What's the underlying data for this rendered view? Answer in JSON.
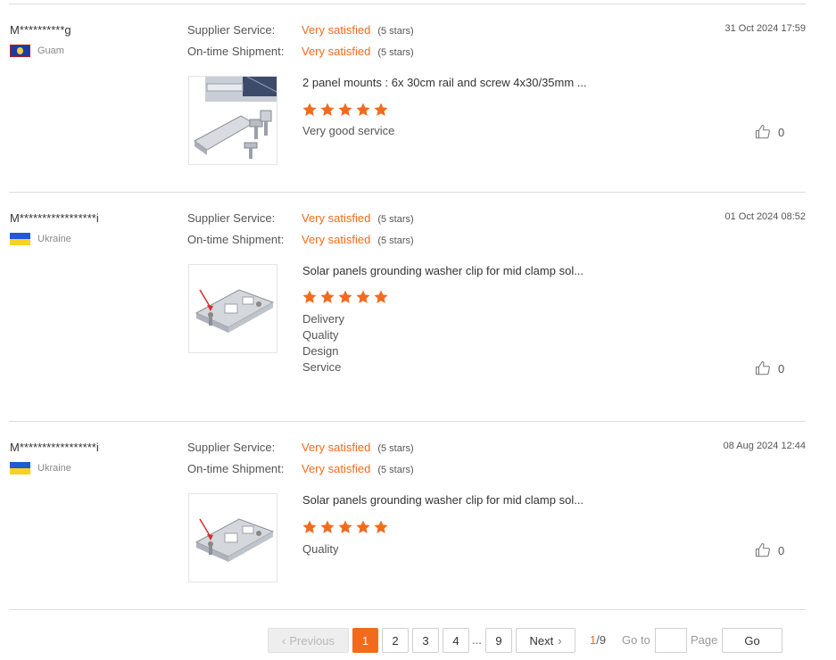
{
  "labels": {
    "supplier_service": "Supplier Service:",
    "on_time_shipment": "On-time Shipment:"
  },
  "reviews": [
    {
      "buyer": "M**********g",
      "country": "Guam",
      "supplier_service": "Very satisfied",
      "supplier_service_stars": "(5 stars)",
      "on_time_shipment": "Very satisfied",
      "on_time_shipment_stars": "(5 stars)",
      "date": "31 Oct 2024 17:59",
      "product": "2 panel mounts : 6x 30cm rail and screw 4x30/35mm ...",
      "rating": 5,
      "comment": [
        "Very good service"
      ],
      "likes": "0"
    },
    {
      "buyer": "M*****************i",
      "country": "Ukraine",
      "supplier_service": "Very satisfied",
      "supplier_service_stars": "(5 stars)",
      "on_time_shipment": "Very satisfied",
      "on_time_shipment_stars": "(5 stars)",
      "date": "01 Oct 2024 08:52",
      "product": "Solar panels grounding washer clip for mid clamp sol...",
      "rating": 5,
      "comment": [
        "Delivery",
        "Quality",
        "Design",
        "Service"
      ],
      "likes": "0"
    },
    {
      "buyer": "M*****************i",
      "country": "Ukraine",
      "supplier_service": "Very satisfied",
      "supplier_service_stars": "(5 stars)",
      "on_time_shipment": "Very satisfied",
      "on_time_shipment_stars": "(5 stars)",
      "date": "08 Aug 2024 12:44",
      "product": "Solar panels grounding washer clip for mid clamp sol...",
      "rating": 5,
      "comment": [
        "Quality"
      ],
      "likes": "0"
    }
  ],
  "pagination": {
    "previous": "Previous",
    "pages": [
      "1",
      "2",
      "3",
      "4"
    ],
    "ellipsis": "...",
    "last_page": "9",
    "next": "Next",
    "current": "1",
    "total": "/9",
    "goto_label": "Go to",
    "page_label": "Page",
    "go_button": "Go",
    "goto_value": ""
  },
  "colors": {
    "accent": "#f26b1d",
    "star": "#f26b1d"
  }
}
